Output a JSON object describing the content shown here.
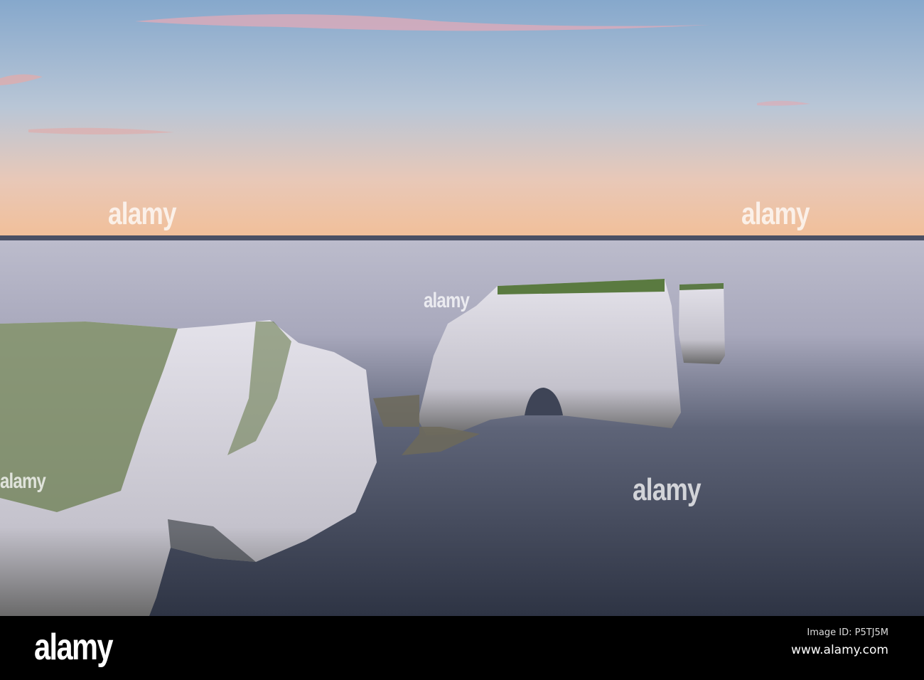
{
  "watermark": {
    "text": "alamy"
  },
  "footer": {
    "logo": "alamy",
    "image_id": "Image ID: P5TJ5M",
    "site": "www.alamy.com"
  }
}
